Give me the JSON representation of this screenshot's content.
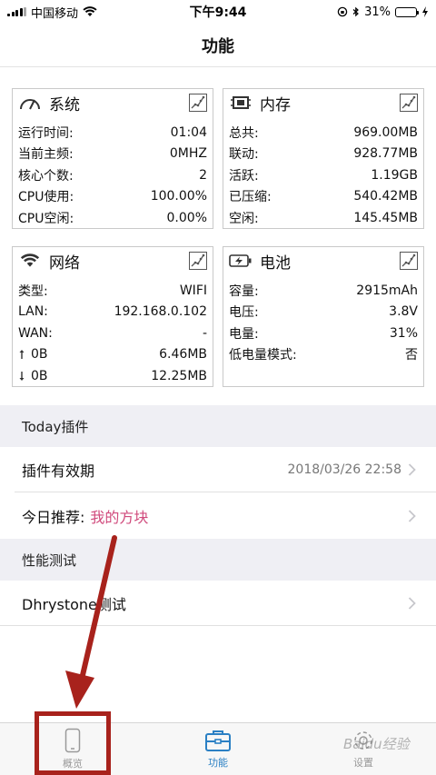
{
  "status_bar": {
    "carrier": "中国移动",
    "time": "下午9:44",
    "battery_percent": "31%",
    "battery_level": 0.31
  },
  "nav": {
    "title": "功能"
  },
  "cards": {
    "system": {
      "title": "系统",
      "rows": [
        {
          "k": "运行时间:",
          "v": "01:04"
        },
        {
          "k": "当前主频:",
          "v": "0MHZ"
        },
        {
          "k": "核心个数:",
          "v": "2"
        },
        {
          "k": "CPU使用:",
          "v": "100.00%"
        },
        {
          "k": "CPU空闲:",
          "v": "0.00%"
        }
      ]
    },
    "memory": {
      "title": "内存",
      "rows": [
        {
          "k": "总共:",
          "v": "969.00MB"
        },
        {
          "k": "联动:",
          "v": "928.77MB"
        },
        {
          "k": "活跃:",
          "v": "1.19GB"
        },
        {
          "k": "已压缩:",
          "v": "540.42MB"
        },
        {
          "k": "空闲:",
          "v": "145.45MB"
        }
      ]
    },
    "network": {
      "title": "网络",
      "rows": [
        {
          "k": "类型:",
          "v": "WIFI"
        },
        {
          "k": "LAN:",
          "v": "192.168.0.102"
        },
        {
          "k": "WAN:",
          "v": "-"
        },
        {
          "k": "0B",
          "v": "6.46MB"
        },
        {
          "k": "0B",
          "v": "12.25MB"
        }
      ]
    },
    "battery": {
      "title": "电池",
      "rows": [
        {
          "k": "容量:",
          "v": "2915mAh"
        },
        {
          "k": "电压:",
          "v": "3.8V"
        },
        {
          "k": "电量:",
          "v": "31%"
        },
        {
          "k": "低电量模式:",
          "v": "否"
        }
      ]
    }
  },
  "sections": {
    "today": "Today插件",
    "perf": "性能测试"
  },
  "list": {
    "plugin_validity_label": "插件有效期",
    "plugin_validity_value": "2018/03/26 22:58",
    "recommend_label": "今日推荐:",
    "recommend_value": "我的方块",
    "dhrystone_label": "Dhrystone测试"
  },
  "tabs": {
    "overview": "概览",
    "functions": "功能",
    "settings": "设置"
  },
  "watermark": "Baidu经验",
  "colors": {
    "accent": "#2b80c4",
    "highlight": "#a8221c",
    "pink": "#d04a7c"
  }
}
